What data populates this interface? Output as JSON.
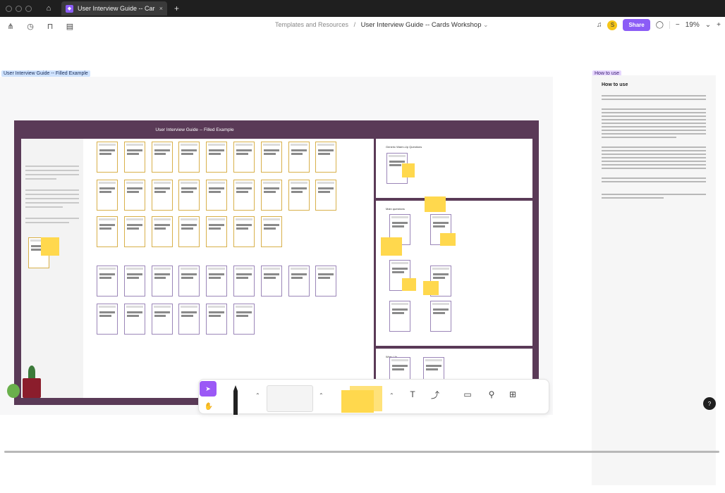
{
  "browser": {
    "tab_title": "User Interview Guide -- Cards Worksho",
    "tab_close": "×",
    "tab_add": "+"
  },
  "toolbar": {
    "breadcrumb_parent": "Templates and Resources",
    "breadcrumb_sep": "/",
    "breadcrumb_current": "User Interview Guide -- Cards Workshop",
    "avatar_initial": "S",
    "share_label": "Share",
    "zoom_minus": "−",
    "zoom_level": "19%",
    "zoom_plus": "+"
  },
  "canvas": {
    "frame1_label": "User Interview Guide -- Filled Example",
    "frame2_label": "How to use",
    "board_title": "User Interview Guide -- Filled Example",
    "how_title": "How to use",
    "section_warmup": "Generic Warm-Up Questions",
    "section_main": "Main questions",
    "section_wrapup": "Wrap-Up"
  },
  "colors": {
    "accent": "#8b5cf6",
    "board_bg": "#5a3a57",
    "sticky": "#ffd84d"
  },
  "help": {
    "label": "?"
  }
}
